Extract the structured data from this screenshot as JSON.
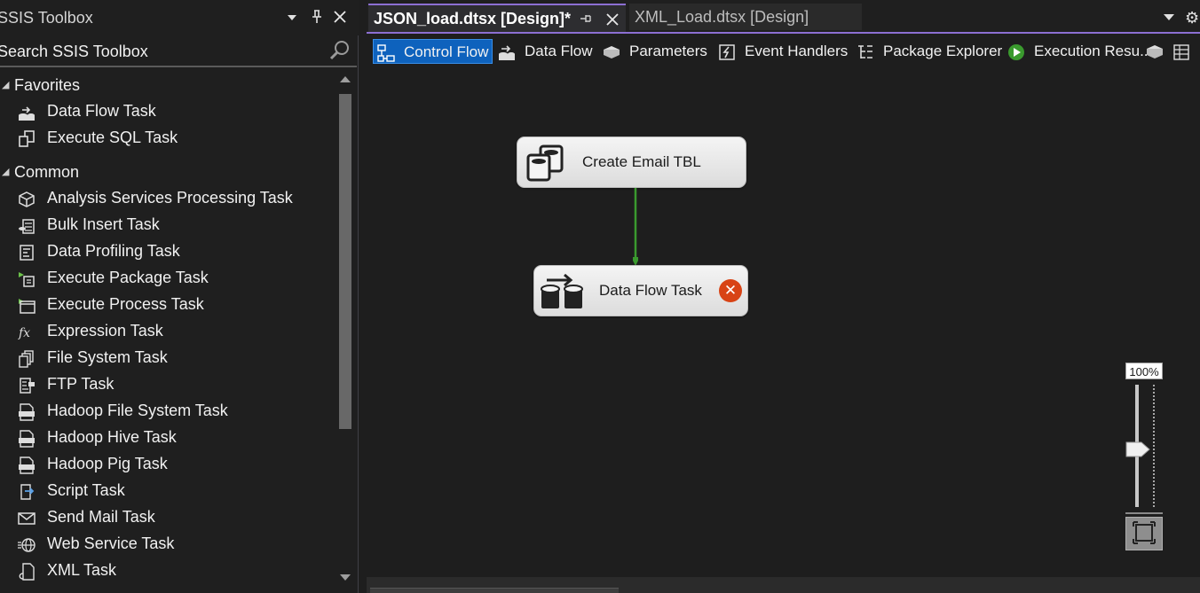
{
  "toolbox": {
    "title": "SSIS Toolbox",
    "search_placeholder": "Search SSIS Toolbox",
    "groups": [
      {
        "label": "Favorites",
        "items": [
          "Data Flow Task",
          "Execute SQL Task"
        ]
      },
      {
        "label": "Common",
        "items": [
          "Analysis Services Processing Task",
          "Bulk Insert Task",
          "Data Profiling Task",
          "Execute Package Task",
          "Execute Process Task",
          "Expression Task",
          "File System Task",
          "FTP Task",
          "Hadoop File System Task",
          "Hadoop Hive Task",
          "Hadoop Pig Task",
          "Script Task",
          "Send Mail Task",
          "Web Service Task",
          "XML Task"
        ]
      }
    ]
  },
  "document_tabs": {
    "active": "JSON_load.dtsx [Design]*",
    "inactive": "XML_Load.dtsx [Design]"
  },
  "designer_tabs": [
    "Control Flow",
    "Data Flow",
    "Parameters",
    "Event Handlers",
    "Package Explorer",
    "Execution Resu.."
  ],
  "tasks": {
    "task1": "Create Email TBL",
    "task2": "Data Flow Task"
  },
  "zoom": {
    "label": "100%"
  },
  "colors": {
    "accent": "#8c6fd2",
    "active_tab": "#0e62bd",
    "precedence_success": "#3a9a2e",
    "error": "#d84315"
  }
}
